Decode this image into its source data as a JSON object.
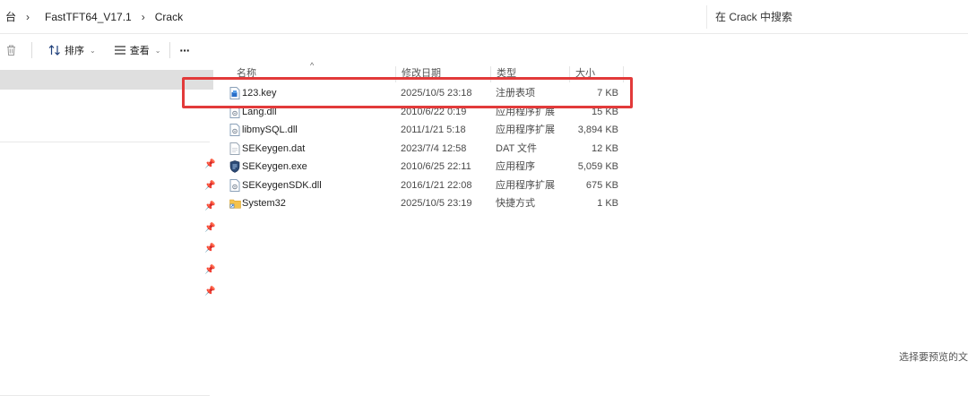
{
  "address": {
    "crumbs": [
      "台",
      "FastTFT64_V17.1",
      "Crack"
    ],
    "separator": "›"
  },
  "search": {
    "text": "在 Crack 中搜索"
  },
  "toolbar": {
    "sort_label": "排序",
    "view_label": "查看",
    "more_label": "···"
  },
  "columns": {
    "name": "名称",
    "date": "修改日期",
    "type": "类型",
    "size": "大小"
  },
  "files": [
    {
      "name": "123.key",
      "date": "2025/10/5 23:18",
      "type": "注册表项",
      "size": "7 KB",
      "icon": "registry-icon"
    },
    {
      "name": "Lang.dll",
      "date": "2010/6/22 0:19",
      "type": "应用程序扩展",
      "size": "15 KB",
      "icon": "dll-icon"
    },
    {
      "name": "libmySQL.dll",
      "date": "2011/1/21 5:18",
      "type": "应用程序扩展",
      "size": "3,894 KB",
      "icon": "dll-icon"
    },
    {
      "name": "SEKeygen.dat",
      "date": "2023/7/4 12:58",
      "type": "DAT 文件",
      "size": "12 KB",
      "icon": "dat-file-icon"
    },
    {
      "name": "SEKeygen.exe",
      "date": "2010/6/25 22:11",
      "type": "应用程序",
      "size": "5,059 KB",
      "icon": "exe-icon"
    },
    {
      "name": "SEKeygenSDK.dll",
      "date": "2016/1/21 22:08",
      "type": "应用程序扩展",
      "size": "675 KB",
      "icon": "dll-icon"
    },
    {
      "name": "System32",
      "date": "2025/10/5 23:19",
      "type": "快捷方式",
      "size": "1 KB",
      "icon": "folder-shortcut-icon"
    }
  ],
  "preview": {
    "hint": "选择要预览的文"
  },
  "colors": {
    "highlight": "#e23a3a",
    "selection": "#dfdfdf"
  }
}
